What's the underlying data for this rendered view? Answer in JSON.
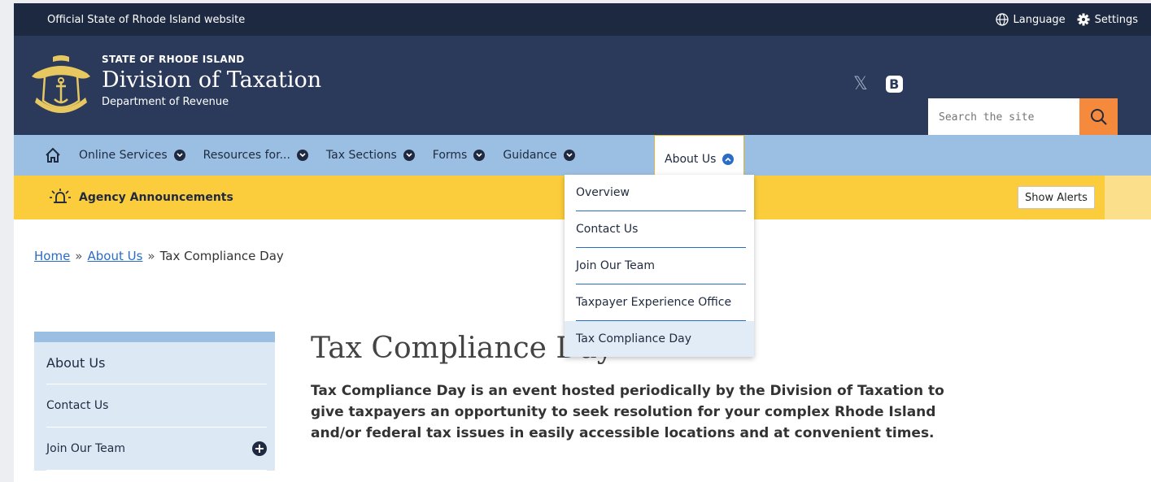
{
  "utility": {
    "official_text": "Official State of Rhode Island website",
    "language_label": "Language",
    "settings_label": "Settings"
  },
  "header": {
    "state_label": "STATE OF RHODE ISLAND",
    "division_title": "Division of Taxation",
    "department": "Department of Revenue",
    "seal_icon": "rhode-island-seal",
    "social": [
      "x-icon",
      "blogger-icon"
    ]
  },
  "search": {
    "placeholder": "Search the site",
    "button_icon": "search-icon"
  },
  "nav": {
    "home_icon": "home-icon",
    "items": [
      {
        "label": "Online Services"
      },
      {
        "label": "Resources for..."
      },
      {
        "label": "Tax Sections"
      },
      {
        "label": "Forms"
      },
      {
        "label": "Guidance"
      },
      {
        "label": "About Us"
      }
    ]
  },
  "alerts": {
    "label": "Agency Announcements",
    "button": "Show Alerts",
    "icon": "bell-icon"
  },
  "dropdown": {
    "items": [
      {
        "label": "Overview"
      },
      {
        "label": "Contact Us"
      },
      {
        "label": "Join Our Team"
      },
      {
        "label": "Taxpayer Experience Office"
      },
      {
        "label": "Tax Compliance Day"
      }
    ]
  },
  "breadcrumb": {
    "home": "Home",
    "about": "About Us",
    "current": "Tax Compliance Day",
    "separator": "»"
  },
  "sidenav": {
    "heading": "About Us",
    "items": [
      {
        "label": "Contact Us"
      },
      {
        "label": "Join Our Team"
      }
    ]
  },
  "page": {
    "title": "Tax Compliance Day",
    "lead": "Tax Compliance Day is an event hosted periodically by the Division of Taxation to give taxpayers an opportunity to seek resolution for your complex Rhode Island and/or federal tax issues in easily accessible locations and at convenient times."
  },
  "colors": {
    "utility_bg": "#1d2940",
    "header_bg": "#2b3a5b",
    "nav_bg": "#9bbfe2",
    "alerts_bg": "#fbcd3c",
    "search_button": "#f58a3c",
    "link": "#2b6cc4"
  }
}
